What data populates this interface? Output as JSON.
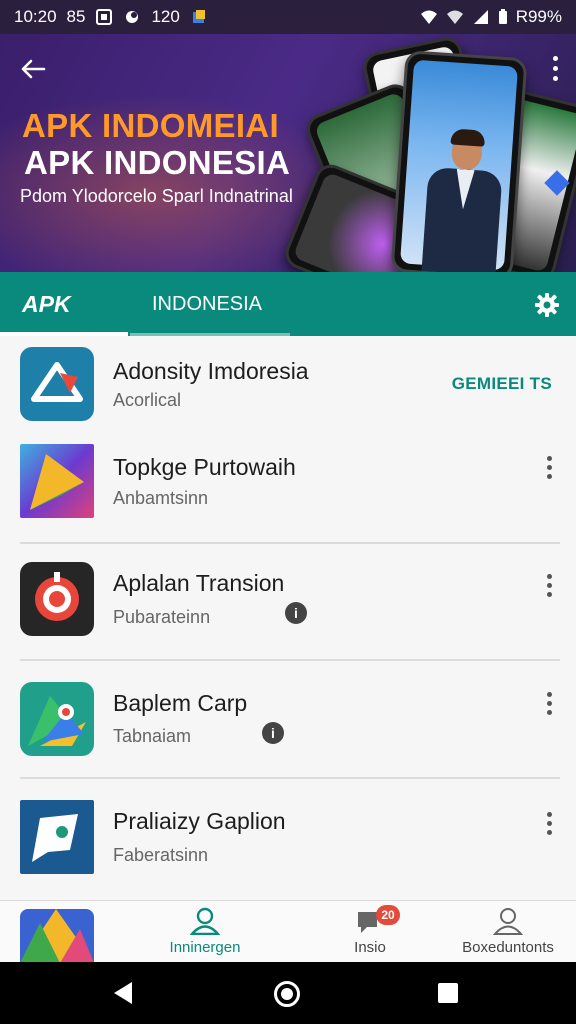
{
  "status_bar": {
    "time": "10:20",
    "extra": "85",
    "num": "120",
    "battery": "R99%"
  },
  "hero": {
    "title_line1": "APK INDOMEIAI",
    "title_line2": "APK INDONESIA",
    "subtitle": "Pdom Ylodorcelo Sparl Indnatrinal"
  },
  "tabs": [
    {
      "label": "APK"
    },
    {
      "label": "INDONESIA"
    }
  ],
  "apps": [
    {
      "title": "Adonsity Imdoresia",
      "subtitle": "Acorlical",
      "action": "GEMIEEI TS"
    },
    {
      "title": "Topkge Purtowaih",
      "subtitle": "Anbamtsinn"
    },
    {
      "title": "Aplalan Transion",
      "subtitle": "Pubarateinn"
    },
    {
      "title": "Baplem Carp",
      "subtitle": "Tabnaiam"
    },
    {
      "title": "Praliaizy Gaplion",
      "subtitle": "Faberatsinn"
    }
  ],
  "bottom_nav": [
    {
      "label": "Inninergen",
      "color": "#0a8a7c"
    },
    {
      "label": "Insio",
      "badge": "20",
      "color": "#444444"
    },
    {
      "label": "Boxeduntonts",
      "color": "#444444"
    }
  ],
  "colors": {
    "accent": "#0a8a7c",
    "hero_orange": "#ff9a2a",
    "badge": "#e24a3a"
  }
}
